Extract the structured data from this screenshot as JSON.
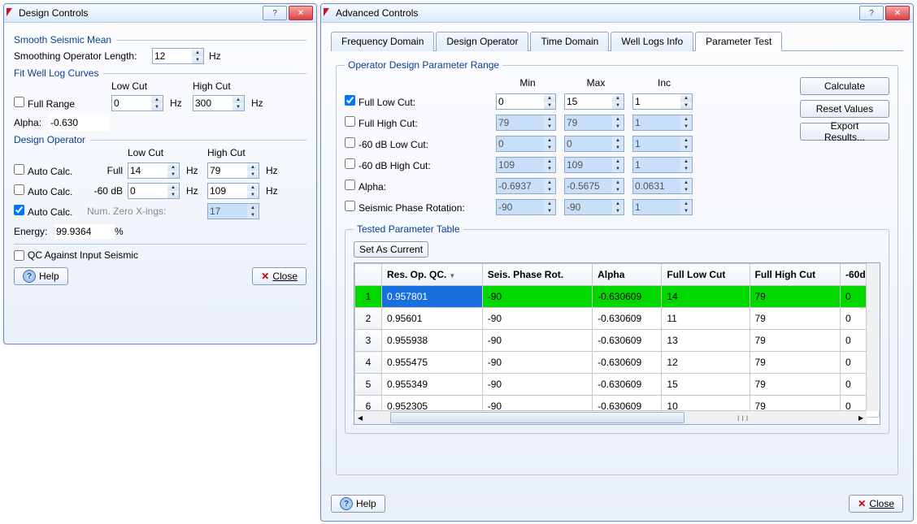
{
  "design": {
    "title": "Design Controls",
    "smooth_section": "Smooth Seismic Mean",
    "smoothing_label": "Smoothing Operator Length:",
    "smoothing_val": "12",
    "hz": "Hz",
    "fit_section": "Fit Well Log Curves",
    "low_cut_hdr": "Low Cut",
    "high_cut_hdr": "High Cut",
    "full_range": "Full Range",
    "full_range_low": "0",
    "full_range_high": "300",
    "alpha_lbl": "Alpha:",
    "alpha_val": "-0.630",
    "design_op_section": "Design Operator",
    "auto_calc": "Auto Calc.",
    "full_lbl": "Full",
    "full_low": "14",
    "full_high": "79",
    "m60": "-60 dB",
    "m60_low": "0",
    "m60_high": "109",
    "num_xings_lbl": "Num. Zero X-ings:",
    "num_xings_val": "17",
    "energy_lbl": "Energy:",
    "energy_val": "99.9364",
    "pct": "%",
    "qc_label": "QC Against Input Seismic",
    "help": "Help",
    "close": "Close"
  },
  "adv": {
    "title": "Advanced Controls",
    "tabs": [
      "Frequency Domain",
      "Design Operator",
      "Time Domain",
      "Well Logs Info",
      "Parameter Test"
    ],
    "range_legend": "Operator Design Parameter Range",
    "hdr_min": "Min",
    "hdr_max": "Max",
    "hdr_inc": "Inc",
    "rows": [
      {
        "label": "Full Low Cut:",
        "checked": true,
        "min": "0",
        "max": "15",
        "inc": "1"
      },
      {
        "label": "Full High Cut:",
        "checked": false,
        "min": "79",
        "max": "79",
        "inc": "1"
      },
      {
        "label": "-60 dB Low Cut:",
        "checked": false,
        "min": "0",
        "max": "0",
        "inc": "1"
      },
      {
        "label": "-60 dB High Cut:",
        "checked": false,
        "min": "109",
        "max": "109",
        "inc": "1"
      },
      {
        "label": "Alpha:",
        "checked": false,
        "min": "-0.6937",
        "max": "-0.5675",
        "inc": "0.0631"
      },
      {
        "label": "Seismic Phase Rotation:",
        "checked": false,
        "min": "-90",
        "max": "-90",
        "inc": "1"
      }
    ],
    "calculate": "Calculate",
    "reset": "Reset Values",
    "export": "Export Results...",
    "tested_legend": "Tested Parameter Table",
    "set_current": "Set As Current",
    "cols": [
      "",
      "Res. Op. QC.",
      "Seis. Phase Rot.",
      "Alpha",
      "Full Low Cut",
      "Full High Cut",
      "-60d"
    ],
    "trows": [
      [
        "1",
        "0.957801",
        "-90",
        "-0.630609",
        "14",
        "79",
        "0"
      ],
      [
        "2",
        "0.95601",
        "-90",
        "-0.630609",
        "11",
        "79",
        "0"
      ],
      [
        "3",
        "0.955938",
        "-90",
        "-0.630609",
        "13",
        "79",
        "0"
      ],
      [
        "4",
        "0.955475",
        "-90",
        "-0.630609",
        "12",
        "79",
        "0"
      ],
      [
        "5",
        "0.955349",
        "-90",
        "-0.630609",
        "15",
        "79",
        "0"
      ],
      [
        "6",
        "0.952305",
        "-90",
        "-0.630609",
        "10",
        "79",
        "0"
      ]
    ],
    "help": "Help",
    "close": "Close"
  }
}
